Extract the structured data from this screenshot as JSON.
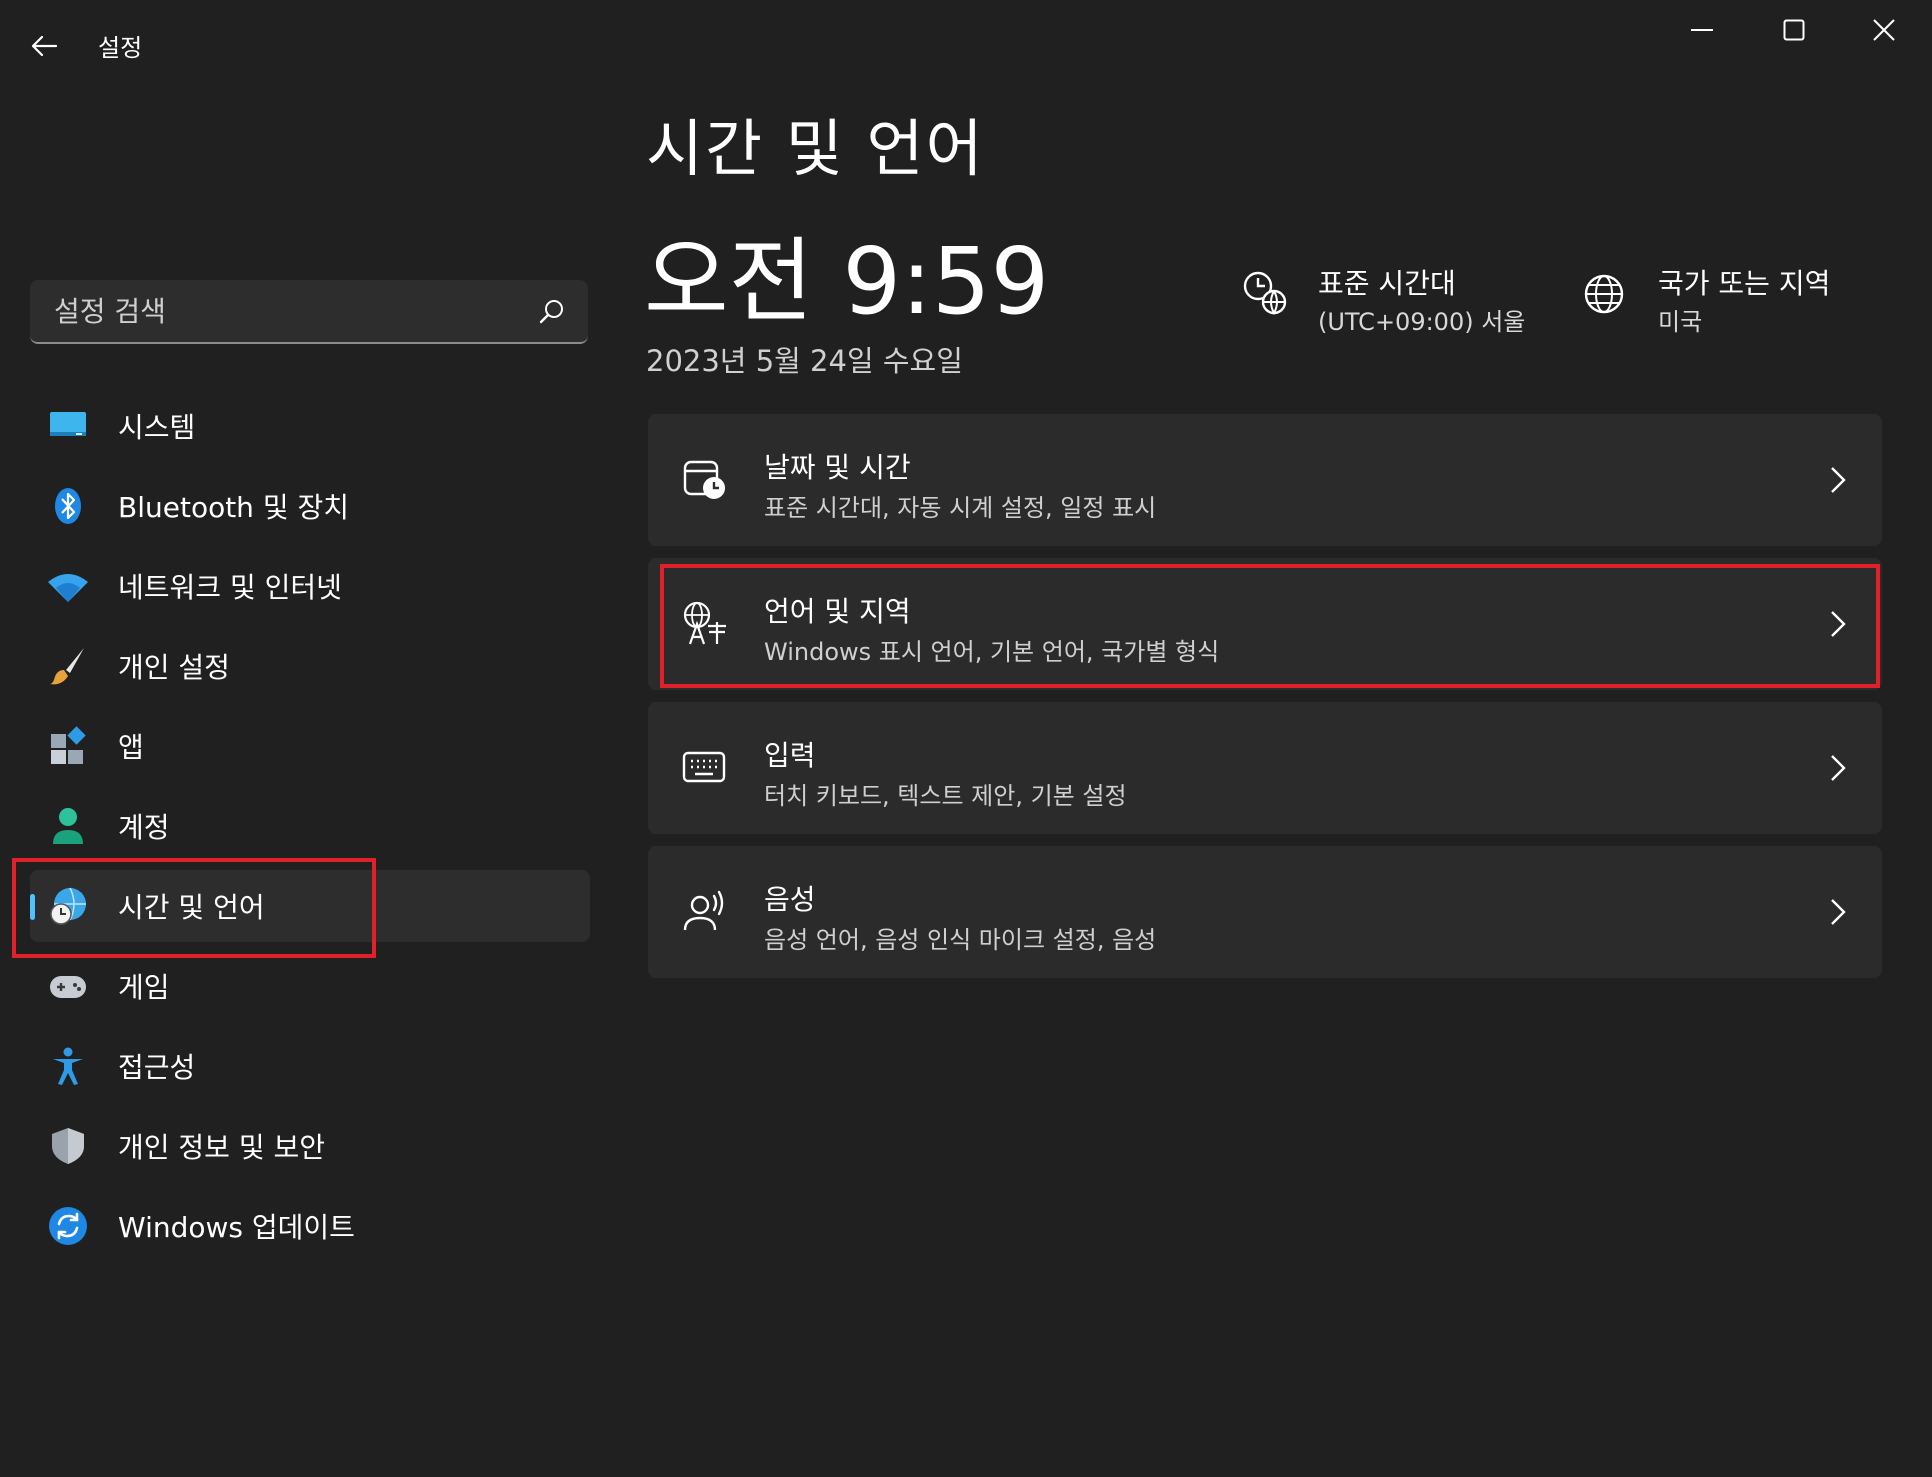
{
  "window": {
    "title": "설정",
    "accent": "#4cc2ff",
    "highlight": "#e0202a"
  },
  "search": {
    "placeholder": "설정 검색",
    "icon": "search-icon"
  },
  "sidebar": {
    "items": [
      {
        "label": "시스템",
        "icon": "system-monitor-icon"
      },
      {
        "label": "Bluetooth 및 장치",
        "icon": "bluetooth-icon"
      },
      {
        "label": "네트워크 및 인터넷",
        "icon": "wifi-icon"
      },
      {
        "label": "개인 설정",
        "icon": "paintbrush-icon"
      },
      {
        "label": "앱",
        "icon": "apps-icon"
      },
      {
        "label": "계정",
        "icon": "person-icon"
      },
      {
        "label": "시간 및 언어",
        "icon": "globe-clock-icon",
        "active": true
      },
      {
        "label": "게임",
        "icon": "gamepad-icon"
      },
      {
        "label": "접근성",
        "icon": "accessibility-icon"
      },
      {
        "label": "개인 정보 및 보안",
        "icon": "shield-icon"
      },
      {
        "label": "Windows 업데이트",
        "icon": "update-icon"
      }
    ]
  },
  "main": {
    "title": "시간 및 언어",
    "clock": "오전 9:59",
    "date": "2023년 5월 24일 수요일",
    "timezone": {
      "title": "표준 시간대",
      "value": "(UTC+09:00) 서울"
    },
    "region": {
      "title": "국가 또는 지역",
      "value": "미국"
    },
    "cards": [
      {
        "title": "날짜 및 시간",
        "subtitle": "표준 시간대, 자동 시계 설정, 일정 표시",
        "icon": "calendar-clock-icon"
      },
      {
        "title": "언어 및 지역",
        "subtitle": "Windows 표시 언어, 기본 언어, 국가별 형식",
        "icon": "language-icon"
      },
      {
        "title": "입력",
        "subtitle": "터치 키보드, 텍스트 제안, 기본 설정",
        "icon": "keyboard-icon"
      },
      {
        "title": "음성",
        "subtitle": "음성 언어, 음성 인식 마이크 설정, 음성",
        "icon": "speech-icon"
      }
    ]
  }
}
